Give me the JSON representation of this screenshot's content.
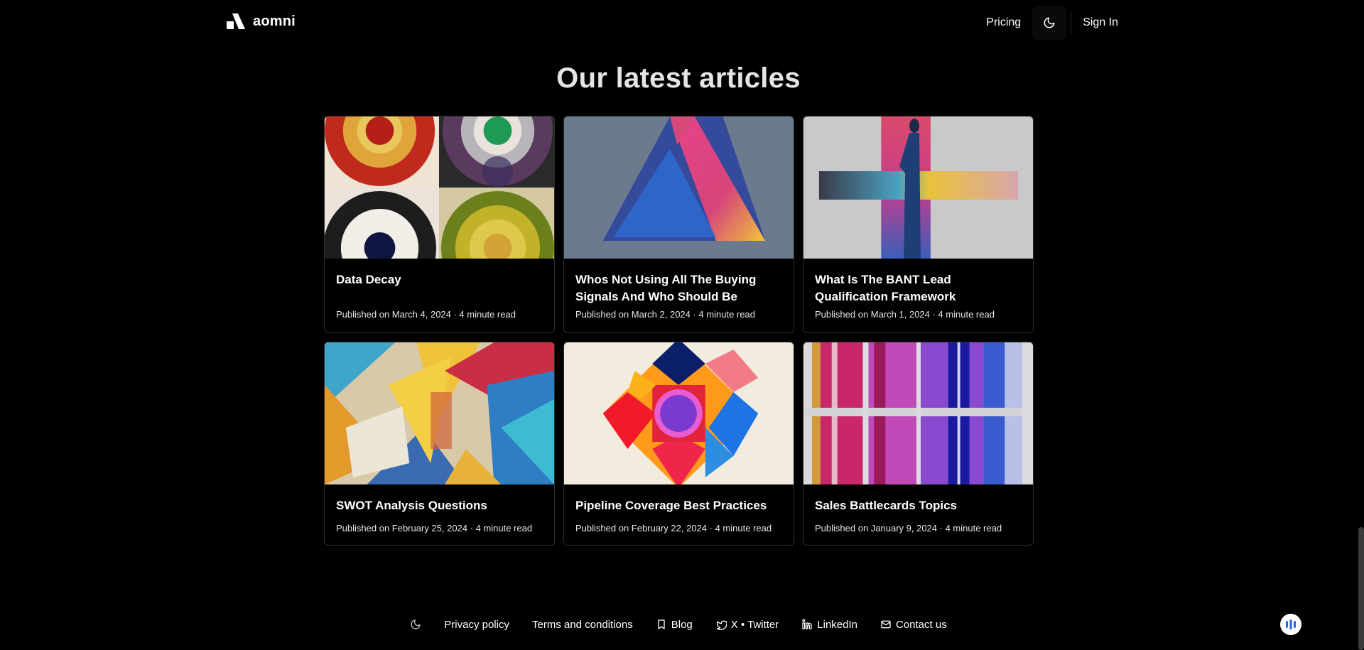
{
  "header": {
    "logo_text": "aomni",
    "nav": {
      "pricing": "Pricing",
      "sign_in": "Sign In"
    }
  },
  "section": {
    "title": "Our latest articles"
  },
  "articles": [
    {
      "title": "Data Decay",
      "meta": "Published on March 4, 2024 · 4 minute read"
    },
    {
      "title": "Whos Not Using All The Buying Signals And Who Should Be",
      "meta": "Published on March 2, 2024 · 4 minute read"
    },
    {
      "title": "What Is The BANT Lead Qualification Framework",
      "meta": "Published on March 1, 2024 · 4 minute read"
    },
    {
      "title": "SWOT Analysis Questions",
      "meta": "Published on February 25, 2024 · 4 minute read"
    },
    {
      "title": "Pipeline Coverage Best Practices",
      "meta": "Published on February 22, 2024 · 4 minute read"
    },
    {
      "title": "Sales Battlecards Topics",
      "meta": "Published on January 9, 2024 · 4 minute read"
    }
  ],
  "footer": {
    "privacy": "Privacy policy",
    "terms": "Terms and conditions",
    "blog": "Blog",
    "twitter": "X • Twitter",
    "linkedin": "LinkedIn",
    "contact": "Contact us"
  },
  "icons": {
    "theme": "moon-icon",
    "blog": "bookmark-icon",
    "twitter": "twitter-icon",
    "linkedin": "linkedin-icon",
    "contact": "mail-icon",
    "widget": "audio-bars-icon"
  },
  "colors": {
    "background": "#000000",
    "text": "#ffffff",
    "widget": "#2563eb"
  }
}
